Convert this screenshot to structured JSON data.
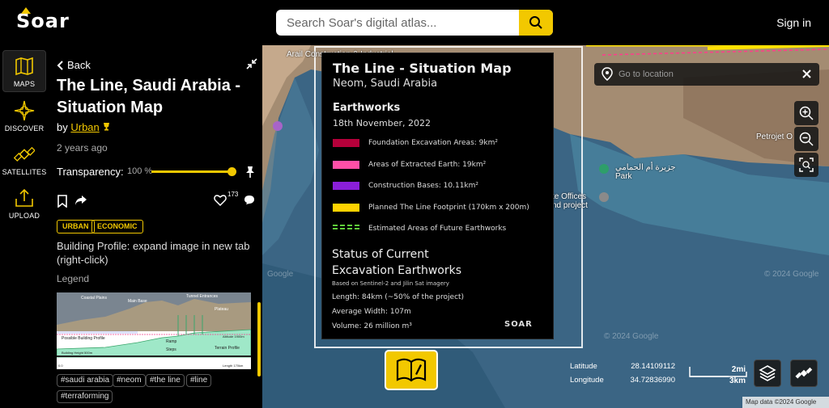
{
  "header": {
    "logo_text": "Soar",
    "search_placeholder": "Search Soar's digital atlas...",
    "signin_label": "Sign in"
  },
  "nav": {
    "items": [
      {
        "label": "MAPS",
        "icon": "map-icon"
      },
      {
        "label": "DISCOVER",
        "icon": "compass-icon"
      },
      {
        "label": "SATELLITES",
        "icon": "satellite-icon"
      },
      {
        "label": "UPLOAD",
        "icon": "upload-icon"
      }
    ]
  },
  "sidebar": {
    "back_label": "Back",
    "title": "The Line, Saudi Arabia - Situation Map",
    "by_prefix": "by",
    "author": "Urban",
    "age": "2 years ago",
    "transparency_label": "Transparency:",
    "transparency_value": "100 %",
    "transparency_level": 1.0,
    "like_count": "173",
    "tags": [
      "URBAN",
      "ECONOMIC"
    ],
    "description": "Building Profile: expand image in new tab (right-click)",
    "legend_label": "Legend",
    "legend_image": {
      "labels": [
        "Coastal Plains",
        "Main Base",
        "Tunnel Entrances",
        "Plateau",
        "Possible Building Profile",
        "Ramp",
        "Steps",
        "Altitude 1900m",
        "Terrain Profile",
        "Building Height 500m",
        "Length 170km",
        "0.0"
      ]
    },
    "hashtags": [
      "#saudi arabia",
      "#neom",
      "#the line",
      "#line",
      "#terraforming"
    ]
  },
  "situation_map": {
    "title": "The Line - Situation Map",
    "subtitle": "Neom, Saudi Arabia",
    "section_heading": "Earthworks",
    "date": "18th November, 2022",
    "legend": [
      {
        "color": "#b5003a",
        "label": "Foundation Excavation Areas: 9km²"
      },
      {
        "color": "#ff4fa7",
        "label": "Areas of Extracted Earth: 19km²"
      },
      {
        "color": "#8a1fd9",
        "label": "Construction Bases: 10.11km²"
      },
      {
        "color": "#ffd200",
        "label": "Planned The Line Footprint (170km x 200m)"
      },
      {
        "color": "#5fcf3a",
        "label": "Estimated Areas of Future Earthworks",
        "dashed": true
      }
    ],
    "status_heading_1": "Status of Current",
    "status_heading_2": "Excavation Earthworks",
    "status_source": "Based on Sentinel-2 and Jilin Sat imagery",
    "length": "Length: 84km (~50% of the project)",
    "avg_width": "Average Width: 107m",
    "volume": "Volume: 26 million m³",
    "brand": "SOAR"
  },
  "map": {
    "goto_placeholder": "Go to location",
    "labels": [
      "Arail Construction & Industrial",
      "Petrojet O",
      "جزيرة أم الحمامي",
      "Park",
      "te Offices",
      "nd project",
      "Google",
      "© 2024 Google",
      "© 2024 Google"
    ],
    "latitude_label": "Latitude",
    "latitude_value": "28.14109112",
    "longitude_label": "Longitude",
    "longitude_value": "34.72836990",
    "scale_mi": "2mi",
    "scale_km": "3km",
    "attribution": "Map data ©2024 Google"
  }
}
